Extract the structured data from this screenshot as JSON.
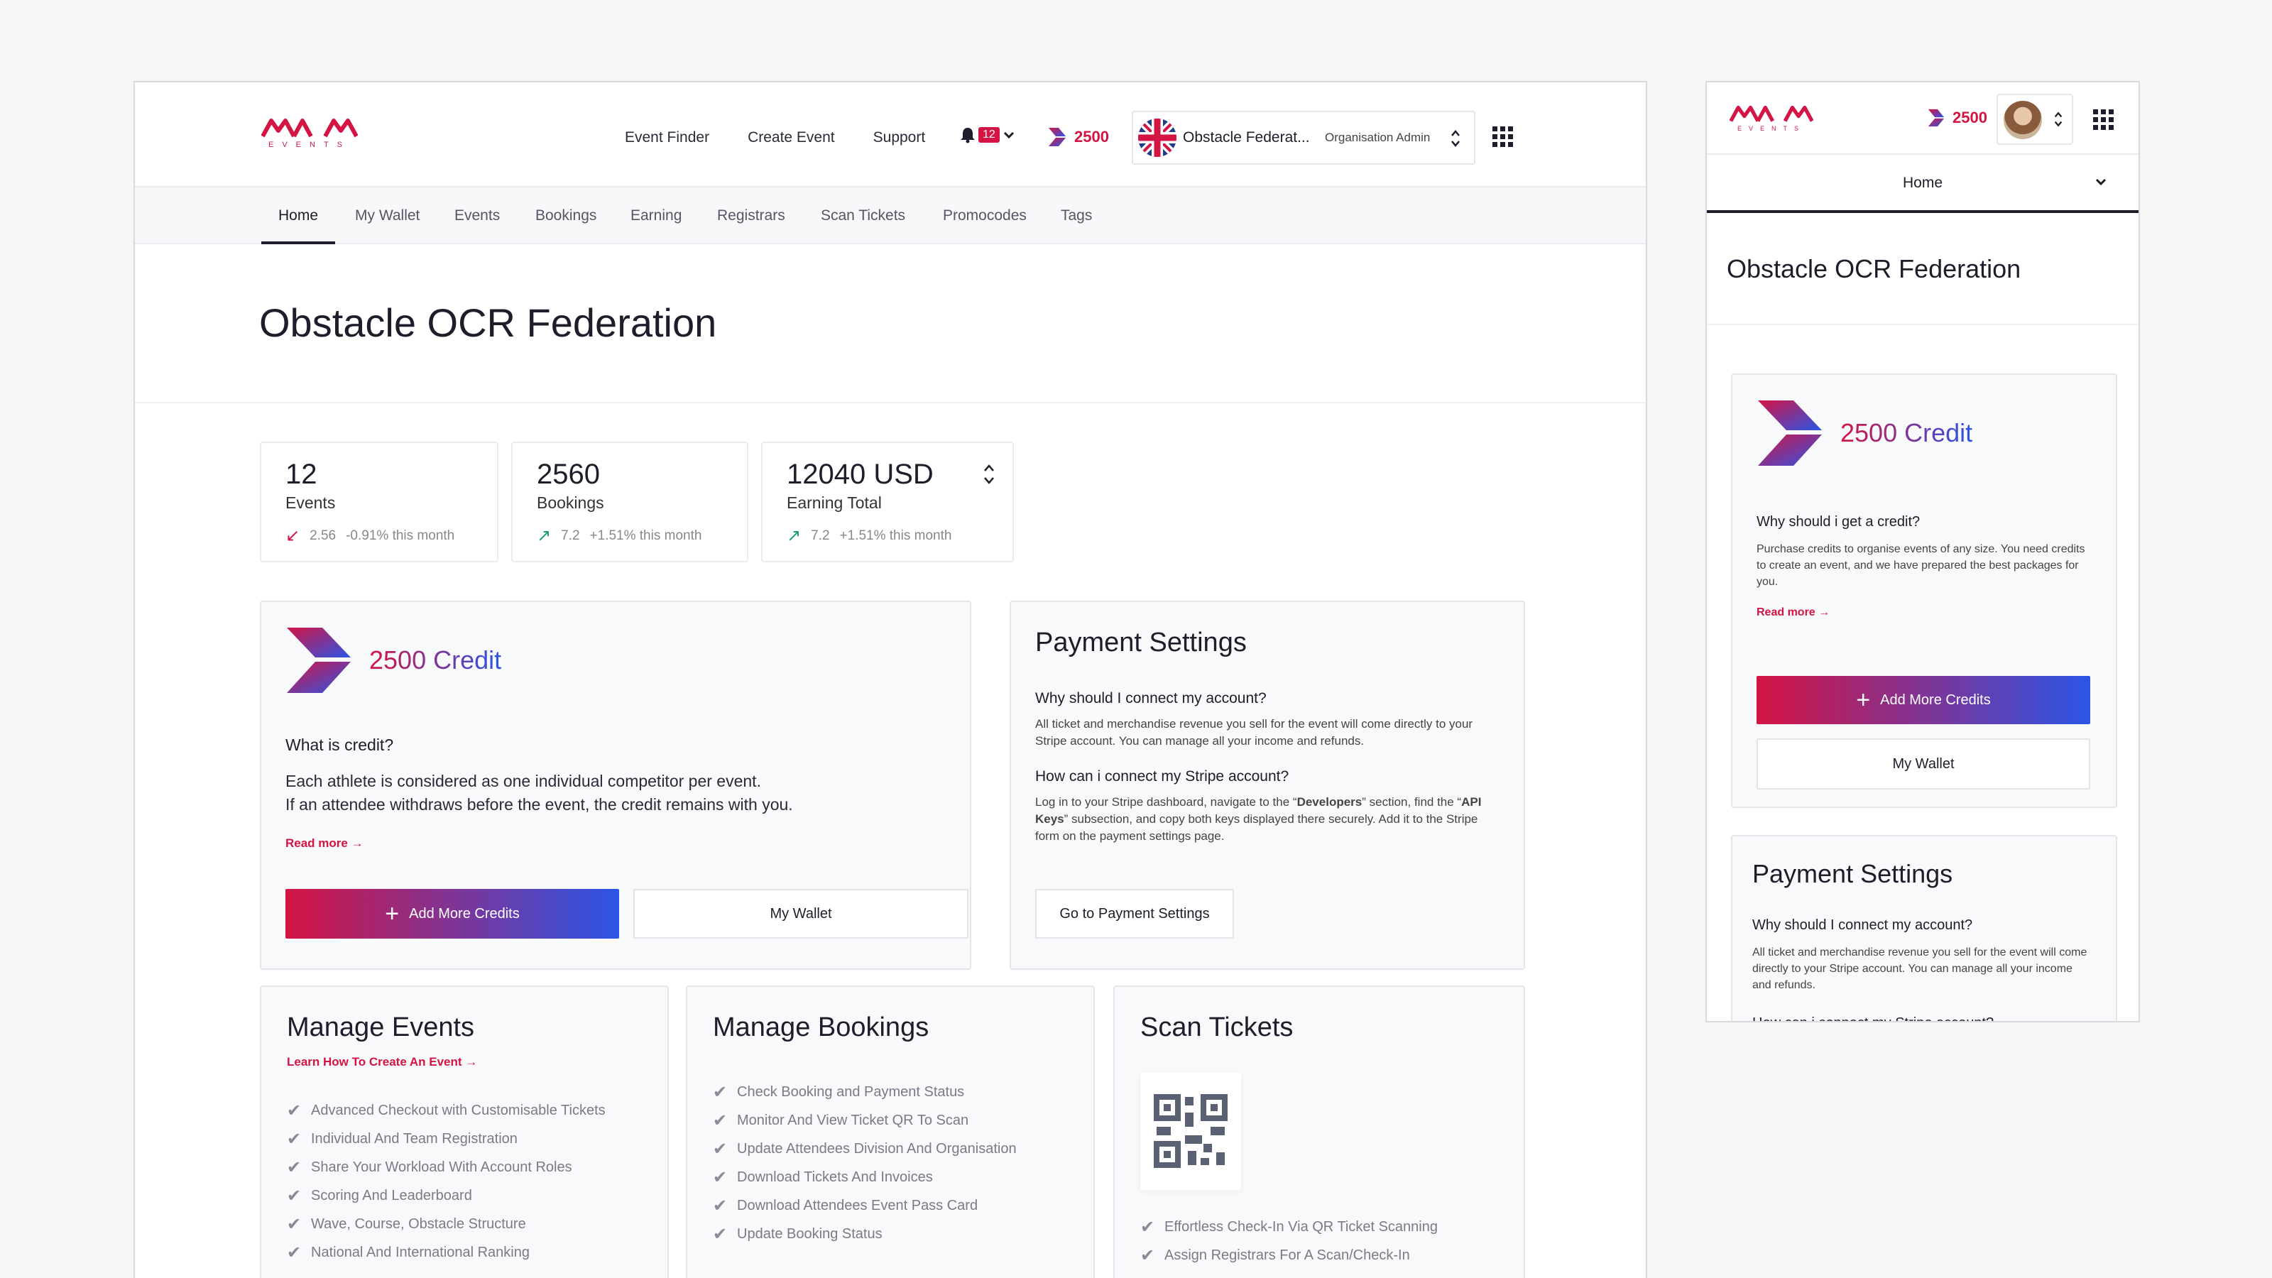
{
  "brand": {
    "logo_sub": "EVENTS"
  },
  "nav": {
    "links": [
      "Event Finder",
      "Create Event",
      "Support"
    ],
    "notifications_count": "12",
    "credits": "2500",
    "org_name": "Obstacle Federat...",
    "org_role": "Organisation Admin"
  },
  "tabs": [
    "Home",
    "My Wallet",
    "Events",
    "Bookings",
    "Earning",
    "Registrars",
    "Scan Tickets",
    "Promocodes",
    "Tags"
  ],
  "page_title": "Obstacle OCR Federation",
  "stats": [
    {
      "value": "12",
      "label": "Events",
      "delta_value": "2.56",
      "delta_text": "-0.91% this month",
      "trend": "down"
    },
    {
      "value": "2560",
      "label": "Bookings",
      "delta_value": "7.2",
      "delta_text": "+1.51% this month",
      "trend": "up"
    },
    {
      "value": "12040 USD",
      "label": "Earning Total",
      "delta_value": "7.2",
      "delta_text": "+1.51% this month",
      "trend": "up"
    }
  ],
  "credit_card": {
    "amount": "2500 Credit",
    "question": "What is credit?",
    "body_line1": "Each athlete is considered as one individual competitor per event.",
    "body_line2": "If an attendee withdraws before the event, the credit remains with you.",
    "read_more": "Read more →",
    "add_button": "Add More Credits",
    "wallet_button": "My Wallet"
  },
  "payment_card": {
    "title": "Payment Settings",
    "q1": "Why should I connect my account?",
    "a1": "All ticket and merchandise revenue you sell for the event will come directly to your Stripe account. You can manage all your income and refunds.",
    "q2": "How can i connect my Stripe account?",
    "a2_pre": "Log in to your Stripe dashboard, navigate to the “",
    "a2_b1": "Developers",
    "a2_mid": "” section, find the “",
    "a2_b2": "API Keys",
    "a2_post": "” subsection, and copy both keys displayed there securely. Add it to the Stripe form on the payment settings page.",
    "button": "Go to Payment Settings"
  },
  "manage_events": {
    "title": "Manage Events",
    "link": "Learn How To Create An Event →",
    "items": [
      "Advanced Checkout with Customisable Tickets",
      "Individual And Team Registration",
      "Share Your Workload With Account Roles",
      "Scoring And Leaderboard",
      "Wave, Course, Obstacle Structure",
      "National And International Ranking"
    ]
  },
  "manage_bookings": {
    "title": "Manage Bookings",
    "items": [
      "Check Booking and Payment Status",
      "Monitor And View Ticket QR To Scan",
      "Update Attendees Division And Organisation",
      "Download Tickets And Invoices",
      "Download Attendees Event Pass Card",
      "Update Booking Status"
    ]
  },
  "scan_tickets": {
    "title": "Scan Tickets",
    "items": [
      "Effortless Check-In Via QR Ticket Scanning",
      "Assign Registrars For A Scan/Check-In"
    ]
  },
  "mobile": {
    "credits": "2500",
    "tab_select": "Home",
    "page_title": "Obstacle OCR Federation",
    "credit_amount": "2500 Credit",
    "credit_q": "Why should i get a credit?",
    "credit_body": "Purchase credits to organise events of any size. You need credits to create an event, and we have prepared the best packages for you.",
    "read_more": "Read more →",
    "add_button": "Add More Credits",
    "wallet_button": "My Wallet",
    "payment_title": "Payment Settings",
    "payment_q1": "Why should I connect my account?",
    "payment_a1": "All ticket and merchandise revenue you sell for the event will come directly to your Stripe account. You can manage all your income and refunds.",
    "payment_q2": "How can i connect my Stripe account?"
  },
  "colors": {
    "accent_red": "#d41443",
    "accent_blue": "#2b55e6"
  }
}
